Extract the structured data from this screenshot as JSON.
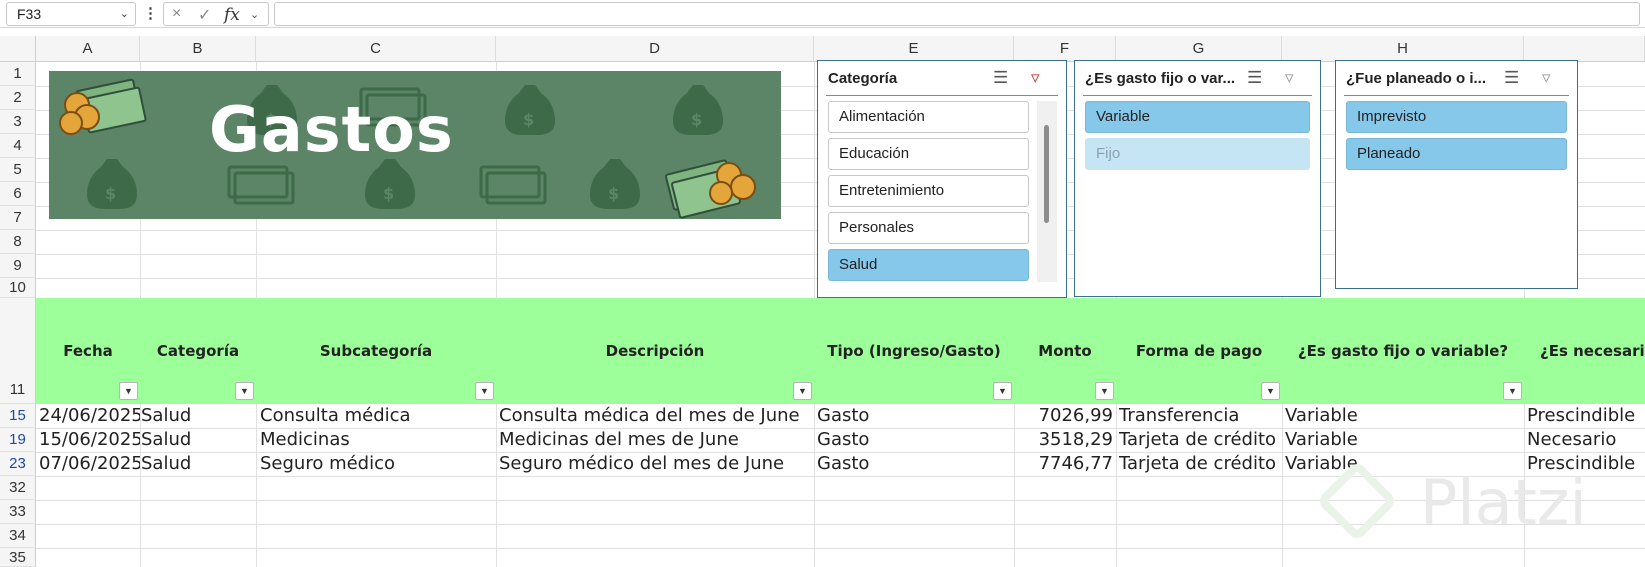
{
  "formula_bar": {
    "name_box": "F33",
    "cancel_icon": "×",
    "enter_icon": "✓",
    "fx_label": "fx",
    "formula": ""
  },
  "columns": [
    "A",
    "B",
    "C",
    "D",
    "E",
    "F",
    "G",
    "H"
  ],
  "rows": [
    {
      "num": "1"
    },
    {
      "num": "2"
    },
    {
      "num": "3"
    },
    {
      "num": "4"
    },
    {
      "num": "5"
    },
    {
      "num": "6"
    },
    {
      "num": "7"
    },
    {
      "num": "8"
    },
    {
      "num": "9"
    },
    {
      "num": "10"
    },
    {
      "num": "11"
    },
    {
      "num": "15"
    },
    {
      "num": "19"
    },
    {
      "num": "23"
    },
    {
      "num": "32"
    },
    {
      "num": "33"
    },
    {
      "num": "34"
    },
    {
      "num": "35"
    }
  ],
  "banner": {
    "title": "Gastos",
    "colors": {
      "background": "#5b8566",
      "motif": "#3f6a4a"
    }
  },
  "table": {
    "headers": [
      "Fecha",
      "Categoría",
      "Subcategoría",
      "Descripción",
      "Tipo (Ingreso/Gasto)",
      "Monto",
      "Forma de pago",
      "¿Es gasto fijo o variable?",
      "¿Es necesari"
    ],
    "header_color": "#9dff9a",
    "rows": [
      [
        "24/06/2025",
        "Salud",
        "Consulta médica",
        "Consulta médica del mes de June",
        "Gasto",
        "7026,99",
        "Transferencia",
        "Variable",
        "Prescindible"
      ],
      [
        "15/06/2025",
        "Salud",
        "Medicinas",
        "Medicinas del mes de June",
        "Gasto",
        "3518,29",
        "Tarjeta de crédito",
        "Variable",
        "Necesario"
      ],
      [
        "07/06/2025",
        "Salud",
        "Seguro médico",
        "Seguro médico del mes de June",
        "Gasto",
        "7746,77",
        "Tarjeta de crédito",
        "Variable",
        "Prescindible"
      ]
    ]
  },
  "slicers": [
    {
      "title": "Categoría",
      "items": [
        {
          "label": "Alimentación",
          "state": "normal"
        },
        {
          "label": "Educación",
          "state": "normal"
        },
        {
          "label": "Entretenimiento",
          "state": "normal"
        },
        {
          "label": "Personales",
          "state": "normal"
        },
        {
          "label": "Salud",
          "state": "selected"
        }
      ]
    },
    {
      "title": "¿Es gasto fijo o var...",
      "items": [
        {
          "label": "Variable",
          "state": "selected"
        },
        {
          "label": "Fijo",
          "state": "dim"
        }
      ]
    },
    {
      "title": "¿Fue planeado o i...",
      "items": [
        {
          "label": "Imprevisto",
          "state": "selected"
        },
        {
          "label": "Planeado",
          "state": "selected"
        }
      ]
    }
  ],
  "watermark": "Platzi"
}
